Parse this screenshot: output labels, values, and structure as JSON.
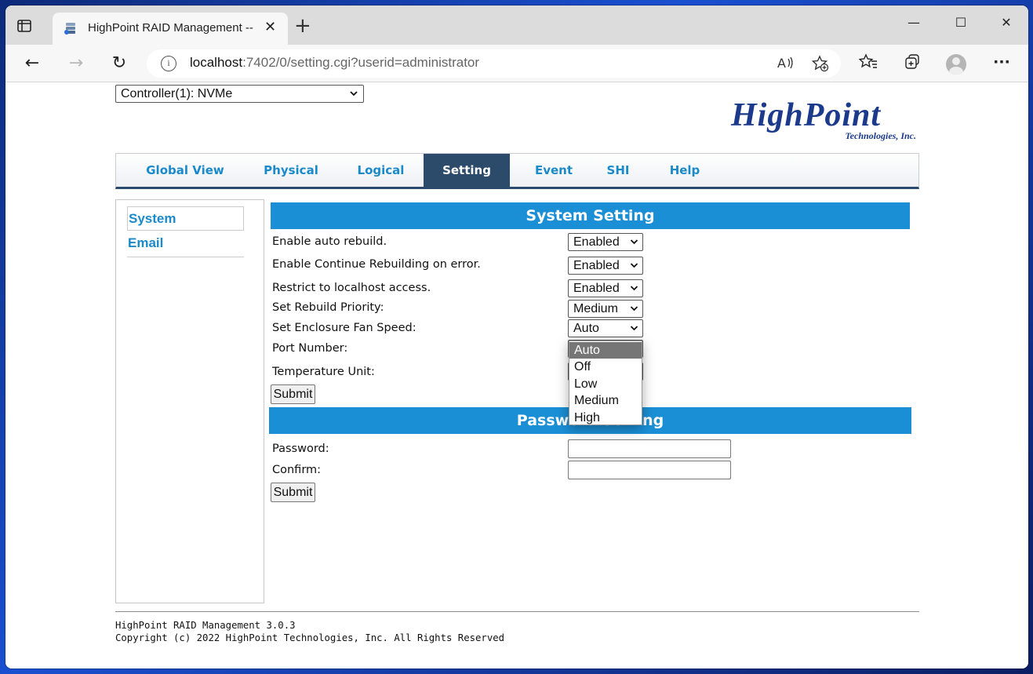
{
  "browser": {
    "tab_title": "HighPoint RAID Management --",
    "url_host": "localhost",
    "url_rest": ":7402/0/setting.cgi?userid=administrator"
  },
  "icons": {
    "tab_actions": "tab-actions-icon",
    "favicon": "raid-disks-icon",
    "close": "close-icon",
    "new_tab": "plus-icon",
    "minimize": "minimize-icon",
    "maximize": "maximize-icon",
    "window_close": "window-close-icon",
    "back": "back-arrow-icon",
    "forward": "forward-arrow-icon",
    "refresh": "refresh-icon",
    "info": "info-icon",
    "read_aloud": "read-aloud-icon",
    "add_favorite": "add-favorite-icon",
    "favorites": "favorites-icon",
    "collections": "collections-icon",
    "profile": "profile-avatar-icon",
    "more": "more-icon"
  },
  "glyphs": {
    "close": "✕",
    "plus": "+",
    "minimize": "—",
    "maximize": "☐",
    "back": "←",
    "forward": "→",
    "refresh": "↻",
    "info": "i",
    "more": "···",
    "chevron": "⌄"
  },
  "controller": {
    "selected": "Controller(1): NVMe"
  },
  "logo": {
    "name": "HighPoint",
    "sub": "Technologies, Inc."
  },
  "menu": {
    "items": [
      {
        "label": "Global View"
      },
      {
        "label": "Physical"
      },
      {
        "label": "Logical"
      },
      {
        "label": "Setting"
      },
      {
        "label": "Event"
      },
      {
        "label": "SHI"
      },
      {
        "label": "Help"
      }
    ],
    "active": "Setting"
  },
  "sidebar": {
    "items": [
      {
        "label": "System"
      },
      {
        "label": "Email"
      }
    ]
  },
  "system_setting": {
    "title": "System Setting",
    "rows": [
      {
        "label": "Enable auto rebuild.",
        "value": "Enabled"
      },
      {
        "label": "Enable Continue Rebuilding on error.",
        "value": "Enabled"
      },
      {
        "label": "Restrict to localhost access.",
        "value": "Enabled"
      },
      {
        "label": "Set Rebuild Priority:",
        "value": "Medium"
      },
      {
        "label": "Set Enclosure Fan Speed:",
        "value": "Auto"
      },
      {
        "label": "Port Number:"
      },
      {
        "label": "Temperature Unit:"
      }
    ],
    "submit": "Submit"
  },
  "fan_dropdown": {
    "options": [
      "Auto",
      "Off",
      "Low",
      "Medium",
      "High"
    ],
    "highlighted": "Auto"
  },
  "password_setting": {
    "title": "Password Setting",
    "password_label": "Password:",
    "confirm_label": "Confirm:",
    "submit": "Submit"
  },
  "footer": {
    "version": "HighPoint RAID Management 3.0.3",
    "copyright": "Copyright (c) 2022 HighPoint Technologies, Inc. All Rights Reserved"
  },
  "colors": {
    "accent": "#1b8fd6",
    "menu_active": "#2c4a6a",
    "link": "#1b8acb",
    "logo": "#1c3a8c"
  }
}
